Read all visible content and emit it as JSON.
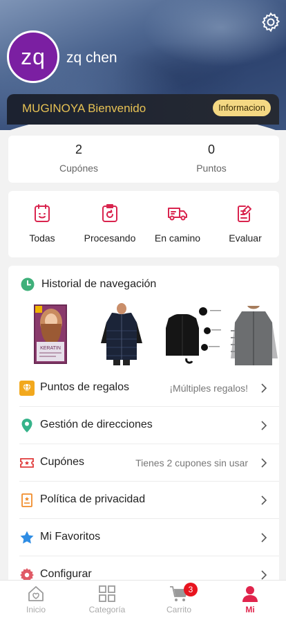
{
  "profile": {
    "avatar_initials": "zq",
    "name": "zq chen",
    "avatar_color": "#7b1fa2"
  },
  "banner": {
    "welcome": "MUGINOYA Bienvenido",
    "info_label": "Informacion"
  },
  "stats": [
    {
      "value": "2",
      "label": "Cupónes"
    },
    {
      "value": "0",
      "label": "Puntos"
    }
  ],
  "orders": [
    {
      "label": "Todas",
      "icon": "all-orders-icon"
    },
    {
      "label": "Procesando",
      "icon": "processing-icon"
    },
    {
      "label": "En camino",
      "icon": "delivery-truck-icon"
    },
    {
      "label": "Evaluar",
      "icon": "review-icon"
    }
  ],
  "history": {
    "title": "Historial de navegación",
    "items": [
      {
        "label": "KERATIN"
      },
      {
        "label": ""
      },
      {
        "label": ""
      },
      {
        "label": ""
      }
    ]
  },
  "menu": [
    {
      "label": "Puntos de regalos",
      "sub": "¡Múltiples regalos!",
      "icon": "gift-diamond-icon"
    },
    {
      "label": "Gestión de direcciones",
      "sub": "",
      "icon": "location-pin-icon"
    },
    {
      "label": "Cupónes",
      "sub": "Tienes 2 cupones sin usar",
      "icon": "coupon-icon"
    },
    {
      "label": "Política de privacidad",
      "sub": "",
      "icon": "privacy-doc-icon"
    },
    {
      "label": "Mi Favoritos",
      "sub": "",
      "icon": "star-icon"
    },
    {
      "label": "Configurar",
      "sub": "",
      "icon": "settings-icon"
    }
  ],
  "tabs": [
    {
      "label": "Inicio",
      "icon": "home-icon"
    },
    {
      "label": "Categoría",
      "icon": "grid-icon"
    },
    {
      "label": "Carrito",
      "icon": "cart-icon",
      "badge": "3"
    },
    {
      "label": "Mi",
      "icon": "person-icon"
    }
  ],
  "colors": {
    "accent": "#e0244c",
    "gold": "#e7c254",
    "badge": "#e8141f"
  }
}
